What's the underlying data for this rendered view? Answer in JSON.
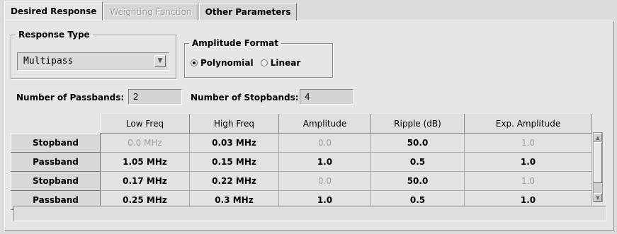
{
  "tabs": [
    {
      "label": "Desired Response",
      "state": "active"
    },
    {
      "label": "Weighting Function",
      "state": "disabled"
    },
    {
      "label": "Other Parameters",
      "state": "normal"
    }
  ],
  "response_type": {
    "title": "Response Type",
    "value": "Multipass"
  },
  "amplitude_format": {
    "title": "Amplitude Format",
    "options": [
      {
        "label": "Polynomial",
        "checked": true
      },
      {
        "label": "Linear",
        "checked": false
      }
    ]
  },
  "passbands": {
    "label": "Number of Passbands:",
    "value": "2"
  },
  "stopbands": {
    "label": "Number of Stopbands:",
    "value": "4"
  },
  "table": {
    "headers": [
      "Low Freq",
      "High Freq",
      "Amplitude",
      "Ripple (dB)",
      "Exp. Amplitude"
    ],
    "rows": [
      {
        "label": "Stopband",
        "cells": [
          "0.0 MHz",
          "0.03 MHz",
          "0.0",
          "50.0",
          "1.0"
        ]
      },
      {
        "label": "Passband",
        "cells": [
          "1.05 MHz",
          "0.15 MHz",
          "1.0",
          "0.5",
          "1.0"
        ]
      },
      {
        "label": "Stopband",
        "cells": [
          "0.17 MHz",
          "0.22 MHz",
          "0.0",
          "50.0",
          "1.0"
        ]
      },
      {
        "label": "Passband",
        "cells": [
          "0.25 MHz",
          "0.3 MHz",
          "1.0",
          "0.5",
          "1.0"
        ]
      }
    ]
  }
}
